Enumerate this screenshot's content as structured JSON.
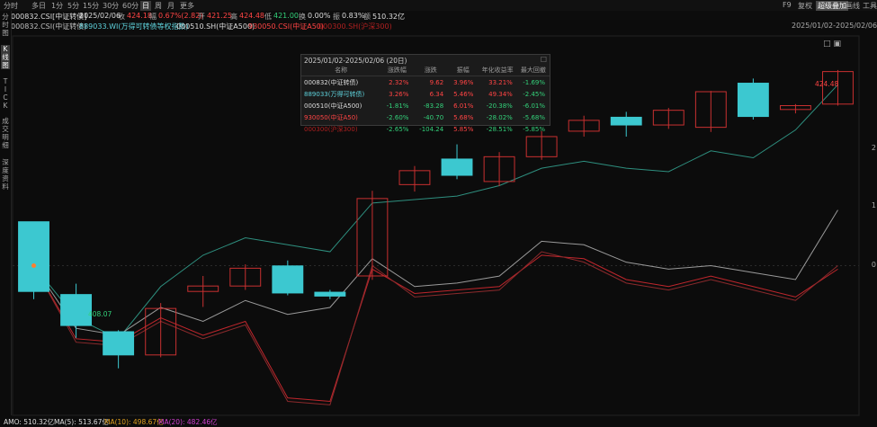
{
  "toolbar": {
    "periods": [
      "分时",
      "多日",
      "1分",
      "5分",
      "15分",
      "30分",
      "60分",
      "日",
      "周",
      "月",
      "更多"
    ],
    "active_period": "日",
    "right": {
      "f9": "F9",
      "fuquan": "复权",
      "super": "超级叠加",
      "draw": "画线",
      "tools": "工具"
    }
  },
  "info": {
    "code": "000832.CSI[中证转债]",
    "date": "2025/02/06",
    "close_label": "收",
    "close": "424.18",
    "change_label": "幅",
    "change": "0.67%(2.82)",
    "open_label": "开",
    "open": "421.25",
    "high_label": "高",
    "high": "424.48",
    "low_label": "低",
    "low": "421.00",
    "turnover_label": "换",
    "turnover": "0.00%",
    "amp_label": "振",
    "amp": "0.83%",
    "amount_label": "额",
    "amount": "510.32亿",
    "range": "2025/01/02-2025/02/06(20"
  },
  "legend": [
    {
      "text": "000832.CSI(中证转债)",
      "color": "#cccccc"
    },
    {
      "text": "889033.WI(万得可转债等权指数)",
      "color": "#5fd3dd"
    },
    {
      "text": "000510.SH(中证A500)",
      "color": "#dddddd"
    },
    {
      "text": "930050.CSI(中证A50)",
      "color": "#ff4444"
    },
    {
      "text": "000300.SH(沪深300)",
      "color": "#b02020"
    }
  ],
  "leftrail": [
    "分",
    "时",
    "图",
    "K",
    "线",
    "图",
    "T",
    "I",
    "C",
    "K",
    "成",
    "交",
    "明",
    "细",
    "深",
    "度",
    "资",
    "料"
  ],
  "panel": {
    "title": "2025/01/02-2025/02/06 (20日)",
    "close": "□",
    "headers": [
      "名称",
      "涨跌幅",
      "涨跌",
      "振幅",
      "年化收益率",
      "最大回撤"
    ],
    "rows": [
      {
        "name": "000832(中证转债)",
        "cells": [
          "2.32%",
          "9.62",
          "3.96%",
          "33.21%",
          "-1.69%"
        ],
        "name_color": "#dddddd",
        "colors": [
          "#ff4444",
          "#ff4444",
          "#ff4444",
          "#ff4444",
          "#33d17a"
        ]
      },
      {
        "name": "889033(万得可转债)",
        "cells": [
          "3.26%",
          "6.34",
          "5.46%",
          "49.34%",
          "-2.45%"
        ],
        "name_color": "#5fd3dd",
        "colors": [
          "#ff4444",
          "#ff4444",
          "#ff4444",
          "#ff4444",
          "#33d17a"
        ]
      },
      {
        "name": "000510(中证A500)",
        "cells": [
          "-1.81%",
          "-83.28",
          "6.01%",
          "-20.38%",
          "-6.01%"
        ],
        "name_color": "#dddddd",
        "colors": [
          "#33d17a",
          "#33d17a",
          "#ff4444",
          "#33d17a",
          "#33d17a"
        ]
      },
      {
        "name": "930050(中证A50)",
        "cells": [
          "-2.60%",
          "-40.70",
          "5.68%",
          "-28.02%",
          "-5.68%"
        ],
        "name_color": "#ff4444",
        "colors": [
          "#33d17a",
          "#33d17a",
          "#ff4444",
          "#33d17a",
          "#33d17a"
        ]
      },
      {
        "name": "000300(沪深300)",
        "cells": [
          "-2.65%",
          "-104.24",
          "5.85%",
          "-28.51%",
          "-5.85%"
        ],
        "name_color": "#b02020",
        "colors": [
          "#33d17a",
          "#33d17a",
          "#ff4444",
          "#33d17a",
          "#33d17a"
        ]
      }
    ]
  },
  "right_axis": [
    "2",
    "1",
    "0"
  ],
  "labels": {
    "high_mark": "424.48",
    "low_mark": "408.07"
  },
  "bottom": {
    "amo": "AMO: 510.32亿",
    "ma5": "MA(5): 513.67亿",
    "ma10": "MA(10): 498.67亿",
    "ma20": "MA(20): 482.46亿"
  },
  "colors": {
    "up": "#ff4444",
    "down": "#3cc8d0",
    "bg": "#0c0c0c",
    "panel": "#1b1b1b"
  },
  "chart_data": {
    "type": "candlestick",
    "candles": [
      {
        "o": 427.0,
        "c": 418.0,
        "h": 427.0,
        "l": 417.0
      },
      {
        "o": 417.6,
        "c": 413.6,
        "h": 419.0,
        "l": 412.0
      },
      {
        "o": 412.8,
        "c": 409.8,
        "h": 413.0,
        "l": 408.07
      },
      {
        "o": 409.8,
        "c": 415.8,
        "h": 416.5,
        "l": 409.5
      },
      {
        "o": 418.0,
        "c": 418.7,
        "h": 420.0,
        "l": 416.0
      },
      {
        "o": 418.7,
        "c": 421.0,
        "h": 421.5,
        "l": 418.2
      },
      {
        "o": 421.3,
        "c": 417.8,
        "h": 422.0,
        "l": 417.5
      },
      {
        "o": 417.9,
        "c": 417.4,
        "h": 418.2,
        "l": 417.0
      },
      {
        "o": 420.0,
        "c": 430.0,
        "h": 431.0,
        "l": 419.5
      },
      {
        "o": 431.8,
        "c": 433.6,
        "h": 434.2,
        "l": 430.9
      },
      {
        "o": 435.1,
        "c": 433.0,
        "h": 437.0,
        "l": 432.5
      },
      {
        "o": 432.2,
        "c": 435.4,
        "h": 436.0,
        "l": 431.6
      },
      {
        "o": 435.4,
        "c": 438.0,
        "h": 438.7,
        "l": 435.0
      },
      {
        "o": 438.7,
        "c": 440.1,
        "h": 440.7,
        "l": 438.0
      },
      {
        "o": 440.5,
        "c": 439.5,
        "h": 441.2,
        "l": 438.0
      },
      {
        "o": 439.5,
        "c": 441.4,
        "h": 441.7,
        "l": 439.0
      },
      {
        "o": 439.2,
        "c": 443.8,
        "h": 443.9,
        "l": 438.6
      },
      {
        "o": 444.9,
        "c": 440.6,
        "h": 445.5,
        "l": 440.2
      },
      {
        "o": 441.5,
        "c": 442.0,
        "h": 442.2,
        "l": 441.0
      },
      {
        "o": 442.2,
        "c": 446.4,
        "h": 446.6,
        "l": 442.0
      }
    ],
    "series": [
      {
        "name": "889033",
        "color": "#2e8f7f",
        "values": [
          0,
          -1.5,
          -2.1,
          -0.6,
          0.3,
          0.8,
          0.6,
          0.4,
          1.8,
          1.9,
          2.0,
          2.3,
          2.8,
          3.0,
          2.8,
          2.7,
          3.3,
          3.1,
          3.9,
          5.2
        ]
      },
      {
        "name": "000510",
        "color": "#9a9a9a",
        "values": [
          0,
          -1.8,
          -2.0,
          -1.2,
          -1.6,
          -1.0,
          -1.4,
          -1.2,
          0.2,
          -0.6,
          -0.5,
          -0.3,
          0.7,
          0.6,
          0.1,
          -0.1,
          0.0,
          -0.2,
          -0.4,
          1.6
        ]
      },
      {
        "name": "930050",
        "color": "#c0262c",
        "values": [
          0,
          -2.1,
          -2.2,
          -1.5,
          -2.0,
          -1.6,
          -3.8,
          -3.9,
          -0.1,
          -0.8,
          -0.7,
          -0.6,
          0.3,
          0.2,
          -0.4,
          -0.6,
          -0.3,
          -0.6,
          -0.9,
          -0.1
        ]
      },
      {
        "name": "000300",
        "color": "#8c2a2c",
        "values": [
          0,
          -2.2,
          -2.3,
          -1.6,
          -2.1,
          -1.7,
          -3.9,
          -4.0,
          0.0,
          -0.9,
          -0.8,
          -0.7,
          0.4,
          0.1,
          -0.5,
          -0.7,
          -0.4,
          -0.7,
          -1.0,
          0.0
        ]
      }
    ],
    "ylim_price": [
      402,
      451
    ],
    "ylim_pct": [
      -4.3,
      6.6
    ]
  }
}
